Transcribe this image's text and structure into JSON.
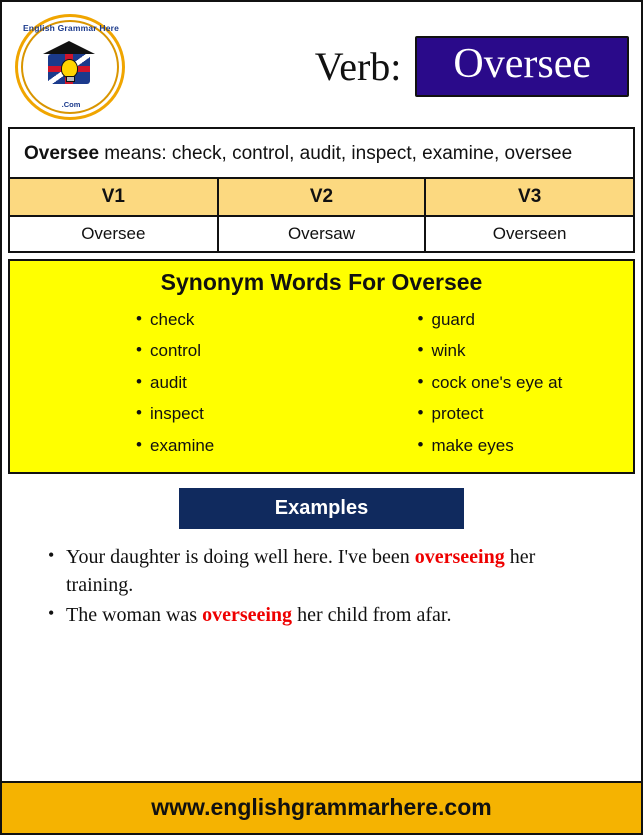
{
  "logo": {
    "top_text": "English Grammar Here",
    "bottom_text": ".Com",
    "alt": "english-grammar-here-logo"
  },
  "header": {
    "verb_label": "Verb:",
    "verb_value": "Oversee"
  },
  "meaning": {
    "word": "Oversee",
    "rest": " means: check, control, audit, inspect, examine, oversee"
  },
  "forms_table": {
    "headers": [
      "V1",
      "V2",
      "V3"
    ],
    "row": [
      "Oversee",
      "Oversaw",
      "Overseen"
    ]
  },
  "synonyms": {
    "title_prefix": "Synonym Words For ",
    "title_word": "Oversee",
    "column_left": [
      "check",
      "control",
      "audit",
      "inspect",
      "examine"
    ],
    "column_right": [
      "guard",
      "wink",
      "cock one's eye at",
      "protect",
      "make eyes"
    ]
  },
  "examples": {
    "header": "Examples",
    "items": [
      {
        "before": "Your daughter is doing well here. I've been ",
        "highlight": "overseeing",
        "after": " her training."
      },
      {
        "before": "The woman was ",
        "highlight": "overseeing",
        "after": " her child from afar."
      }
    ]
  },
  "footer": {
    "url": "www.englishgrammarhere.com"
  },
  "colors": {
    "verb_box": "#2a0a8a",
    "table_header": "#fcd980",
    "synonym_bg": "#ffff00",
    "examples_header": "#102a5e",
    "footer_bg": "#f5b301",
    "highlight": "#ee0000"
  }
}
